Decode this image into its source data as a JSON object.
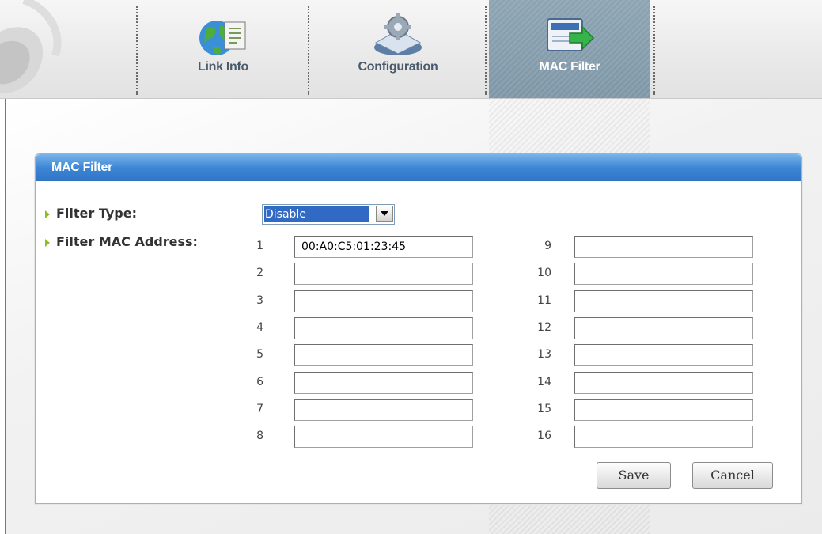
{
  "nav": {
    "tabs": [
      {
        "label": "Link Info",
        "icon": "globe-document-icon"
      },
      {
        "label": "Configuration",
        "icon": "gear-device-icon"
      },
      {
        "label": "MAC Filter",
        "icon": "card-arrow-icon",
        "active": true
      }
    ],
    "active_tab_color": "#8da4b3"
  },
  "panel": {
    "title": "MAC Filter",
    "header_color": "#3d86d6"
  },
  "form": {
    "filter_type_label": "Filter Type:",
    "filter_type_value": "Disable",
    "filter_mac_label": "Filter MAC Address:",
    "bullet_color": "#8cbf1e",
    "addresses": [
      {
        "num": "1",
        "value": "00:A0:C5:01:23:45"
      },
      {
        "num": "2",
        "value": ""
      },
      {
        "num": "3",
        "value": ""
      },
      {
        "num": "4",
        "value": ""
      },
      {
        "num": "5",
        "value": ""
      },
      {
        "num": "6",
        "value": ""
      },
      {
        "num": "7",
        "value": ""
      },
      {
        "num": "8",
        "value": ""
      },
      {
        "num": "9",
        "value": ""
      },
      {
        "num": "10",
        "value": ""
      },
      {
        "num": "11",
        "value": ""
      },
      {
        "num": "12",
        "value": ""
      },
      {
        "num": "13",
        "value": ""
      },
      {
        "num": "14",
        "value": ""
      },
      {
        "num": "15",
        "value": ""
      },
      {
        "num": "16",
        "value": ""
      }
    ]
  },
  "buttons": {
    "save": "Save",
    "cancel": "Cancel"
  }
}
